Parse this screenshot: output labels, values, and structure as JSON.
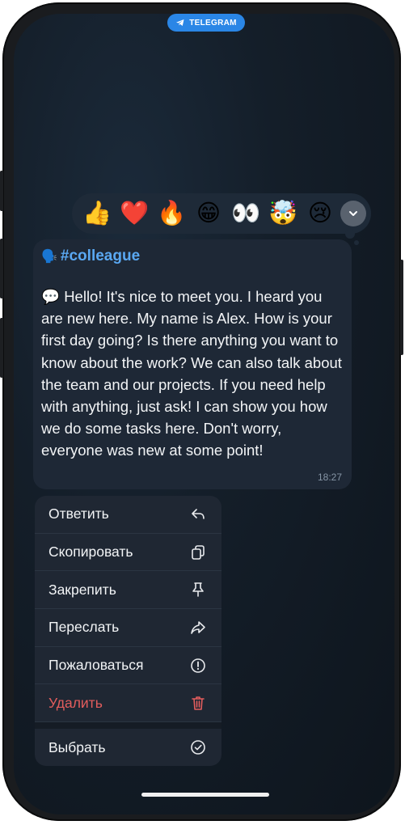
{
  "app": {
    "badge_label": "TELEGRAM"
  },
  "reactions": {
    "emojis": [
      {
        "name": "thumbs-up-emoji",
        "char": "👍"
      },
      {
        "name": "heart-emoji",
        "char": "❤️"
      },
      {
        "name": "fire-emoji",
        "char": "🔥"
      },
      {
        "name": "grin-emoji",
        "char": "😁"
      },
      {
        "name": "eyes-emoji",
        "char": "👀"
      },
      {
        "name": "mind-blown-emoji",
        "char": "🤯"
      },
      {
        "name": "crying-emoji",
        "char": "😢"
      }
    ],
    "expand_icon": "chevron-down-icon"
  },
  "message": {
    "hashtag_emoji": "🗣️",
    "hashtag": "#colleague",
    "text_emoji": "💬",
    "text": "Hello! It's nice to meet you. I heard you are new here. My name is Alex. How is your first day going? Is there anything you want to know about the work? We can also talk about the team and our projects. If you need help with anything, just ask! I can show you how we do some tasks here. Don't worry, everyone was new at some point!",
    "time": "18:27"
  },
  "menu": {
    "items": [
      {
        "label": "Ответить",
        "icon": "reply-icon"
      },
      {
        "label": "Скопировать",
        "icon": "copy-icon"
      },
      {
        "label": "Закрепить",
        "icon": "pin-icon"
      },
      {
        "label": "Переслать",
        "icon": "forward-icon"
      },
      {
        "label": "Пожаловаться",
        "icon": "report-icon"
      },
      {
        "label": "Удалить",
        "icon": "trash-icon",
        "color": "#e35d5d"
      },
      {
        "label": "Выбрать",
        "icon": "select-check-icon"
      }
    ]
  },
  "colors": {
    "accent": "#2a86e6",
    "hashtag": "#5aa8f2",
    "danger": "#e35d5d"
  }
}
